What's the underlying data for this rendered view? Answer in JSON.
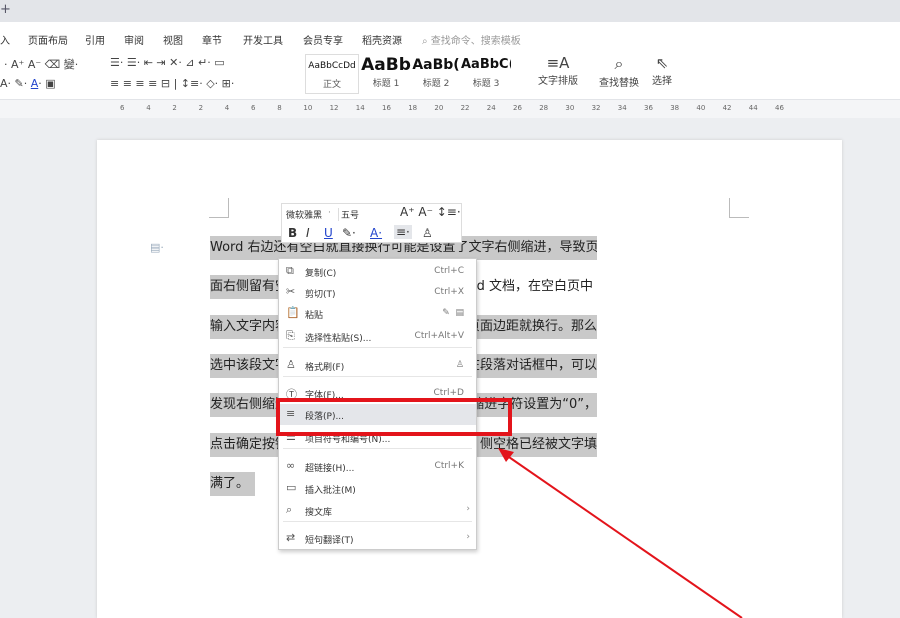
{
  "titlebar": {
    "new_tab_icon": "plus"
  },
  "menu": [
    "入",
    "页面布局",
    "引用",
    "审阅",
    "视图",
    "章节",
    "开发工具",
    "会员专享",
    "稻壳资源"
  ],
  "search": {
    "placeholder": "查找命令、搜索模板"
  },
  "styles": [
    {
      "sample": "AaBbCcDd",
      "label": "正文"
    },
    {
      "sample": "AaBb",
      "label": "标题 1"
    },
    {
      "sample": "AaBb(",
      "label": "标题 2"
    },
    {
      "sample": "AaBbC(",
      "label": "标题 3"
    }
  ],
  "ribbon_buttons": {
    "text_layout": "文字排版",
    "find_replace": "查找替换",
    "select": "选择"
  },
  "ruler": [
    "6",
    "4",
    "2",
    "2",
    "4",
    "6",
    "8",
    "10",
    "12",
    "14",
    "16",
    "18",
    "20",
    "22",
    "24",
    "26",
    "28",
    "30",
    "32",
    "34",
    "36",
    "38",
    "40",
    "42",
    "44",
    "46"
  ],
  "document": {
    "lines": [
      {
        "left": "Word 右边还有空白就直接换行可能是设置了文字右侧缩进，导致页",
        "right": ""
      },
      {
        "left": "面右侧留有空",
        "right": "d 文档，在空白页中"
      },
      {
        "left": "输入文字内容",
        "right": "页面边距就换行。那么"
      },
      {
        "left": "选中该段文字",
        "right": "在段落对话框中，可以"
      },
      {
        "left": "发现右侧缩进",
        "right": "缩进字符设置为“0”，"
      },
      {
        "left": "点击确定按钮",
        "right": "侧空格已经被文字填"
      },
      {
        "left": "满了。",
        "right": ""
      }
    ]
  },
  "minibar": {
    "font": "微软雅黑",
    "size": "五号",
    "bold": "B",
    "italic": "I",
    "underline": "U"
  },
  "context_menu": [
    {
      "label": "复制(C)",
      "shortcut": "Ctrl+C",
      "icon": "copy-icon"
    },
    {
      "label": "剪切(T)",
      "shortcut": "Ctrl+X",
      "icon": "cut-icon"
    },
    {
      "label": "粘贴",
      "shortcut": "",
      "icon": "paste-icon"
    },
    {
      "label": "选择性粘贴(S)...",
      "shortcut": "Ctrl+Alt+V",
      "icon": "paste-special-icon"
    },
    {
      "label": "格式刷(F)",
      "shortcut": "",
      "icon": "format-painter-icon"
    },
    {
      "label": "字体(F)...",
      "shortcut": "Ctrl+D",
      "icon": "font-icon"
    },
    {
      "label": "段落(P)...",
      "shortcut": "",
      "icon": "paragraph-icon"
    },
    {
      "label": "项目符号和编号(N)...",
      "shortcut": "",
      "icon": "bullets-icon"
    },
    {
      "label": "超链接(H)...",
      "shortcut": "Ctrl+K",
      "icon": "link-icon"
    },
    {
      "label": "插入批注(M)",
      "shortcut": "",
      "icon": "comment-icon"
    },
    {
      "label": "搜文库",
      "shortcut": "",
      "icon": "search-library-icon"
    },
    {
      "label": "短句翻译(T)",
      "shortcut": "",
      "icon": "translate-icon"
    }
  ],
  "colors": {
    "highlight": "#e3141b",
    "selection": "#c9c9c9"
  }
}
